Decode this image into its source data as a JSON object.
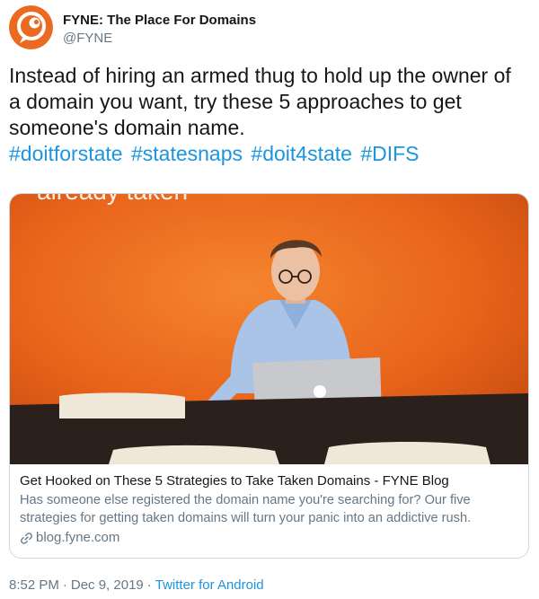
{
  "author": {
    "name": "FYNE: The Place For Domains",
    "handle": "@FYNE"
  },
  "tweet": {
    "text": "Instead of hiring an armed thug to hold up the owner of a domain you want, try these 5 approaches to get someone's domain name.",
    "hashtags": [
      "#doitforstate",
      "#statesnaps",
      "#doit4state",
      "#DIFS"
    ]
  },
  "card": {
    "image_wall_text": "already taken",
    "title": "Get Hooked on These 5 Strategies to Take Taken Domains - FYNE Blog",
    "description": "Has someone else registered the domain name you're searching for? Our five strategies for getting taken domains will turn your panic into an addictive rush.",
    "domain": "blog.fyne.com"
  },
  "meta": {
    "time": "8:52 PM",
    "date": "Dec 9, 2019",
    "separator": "·",
    "source": "Twitter for Android"
  },
  "colors": {
    "link_blue": "#1b95e0",
    "secondary_gray": "#657786",
    "avatar_orange": "#ea6a20",
    "wall_orange": "#e8631a"
  }
}
